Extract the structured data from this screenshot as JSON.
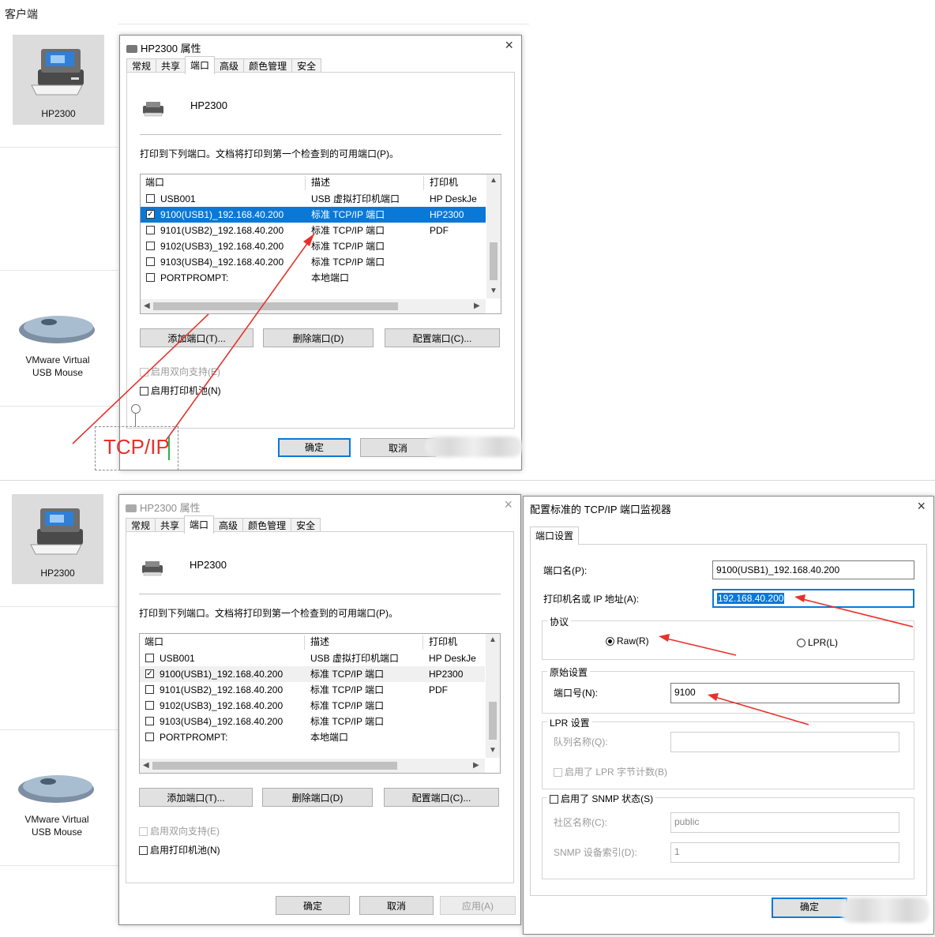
{
  "header": {
    "label": "客户端"
  },
  "devices": [
    {
      "name": "HP2300"
    },
    {
      "name_line1": "VMware Virtual",
      "name_line2": "USB Mouse"
    }
  ],
  "props": {
    "title": "HP2300 属性",
    "close": "×",
    "tabs": [
      "常规",
      "共享",
      "端口",
      "高级",
      "颜色管理",
      "安全"
    ],
    "printer_name": "HP2300",
    "description": "打印到下列端口。文档将打印到第一个检查到的可用端口(P)。",
    "columns": [
      "端口",
      "描述",
      "打印机"
    ],
    "rows": [
      {
        "port": "USB001",
        "desc": "USB 虚拟打印机端口",
        "printer": "HP DeskJe",
        "checked": ""
      },
      {
        "port": "9100(USB1)_192.168.40.200",
        "desc": "标准 TCP/IP 端口",
        "printer": "HP2300",
        "checked": "✓"
      },
      {
        "port": "9101(USB2)_192.168.40.200",
        "desc": "标准 TCP/IP 端口",
        "printer": "PDF",
        "checked": ""
      },
      {
        "port": "9102(USB3)_192.168.40.200",
        "desc": "标准 TCP/IP 端口",
        "printer": "",
        "checked": ""
      },
      {
        "port": "9103(USB4)_192.168.40.200",
        "desc": "标准 TCP/IP 端口",
        "printer": "",
        "checked": ""
      },
      {
        "port": "PORTPROMPT:",
        "desc": "本地端口",
        "printer": "",
        "checked": ""
      }
    ],
    "add_port": "添加端口(T)...",
    "delete_port": "删除端口(D)",
    "configure_port": "配置端口(C)...",
    "bidi": "启用双向支持(E)",
    "pool": "启用打印机池(N)",
    "ok": "确定",
    "cancel": "取消",
    "apply": "应用(A)"
  },
  "annotation": {
    "text": "TCP/IP",
    "color": "#e8312b"
  },
  "tcp": {
    "title": "配置标准的 TCP/IP 端口监视器",
    "close": "×",
    "tab": "端口设置",
    "port_name_label": "端口名(P):",
    "port_name_value": "9100(USB1)_192.168.40.200",
    "host_label": "打印机名或 IP 地址(A):",
    "host_value": "192.168.40.200",
    "protocol_label": "协议",
    "raw": "Raw(R)",
    "lpr": "LPR(L)",
    "raw_settings_label": "原始设置",
    "port_number_label": "端口号(N):",
    "port_number_value": "9100",
    "lpr_settings_label": "LPR 设置",
    "queue_label": "队列名称(Q):",
    "lpr_bytecount": "启用了 LPR 字节计数(B)",
    "snmp_label": "启用了 SNMP 状态(S)",
    "community_label": "社区名称(C):",
    "community_value": "public",
    "snmp_index_label": "SNMP 设备索引(D):",
    "snmp_index_value": "1",
    "ok": "确定"
  },
  "colors": {
    "selection": "#0a78d7",
    "arrow": "#e8312b"
  }
}
